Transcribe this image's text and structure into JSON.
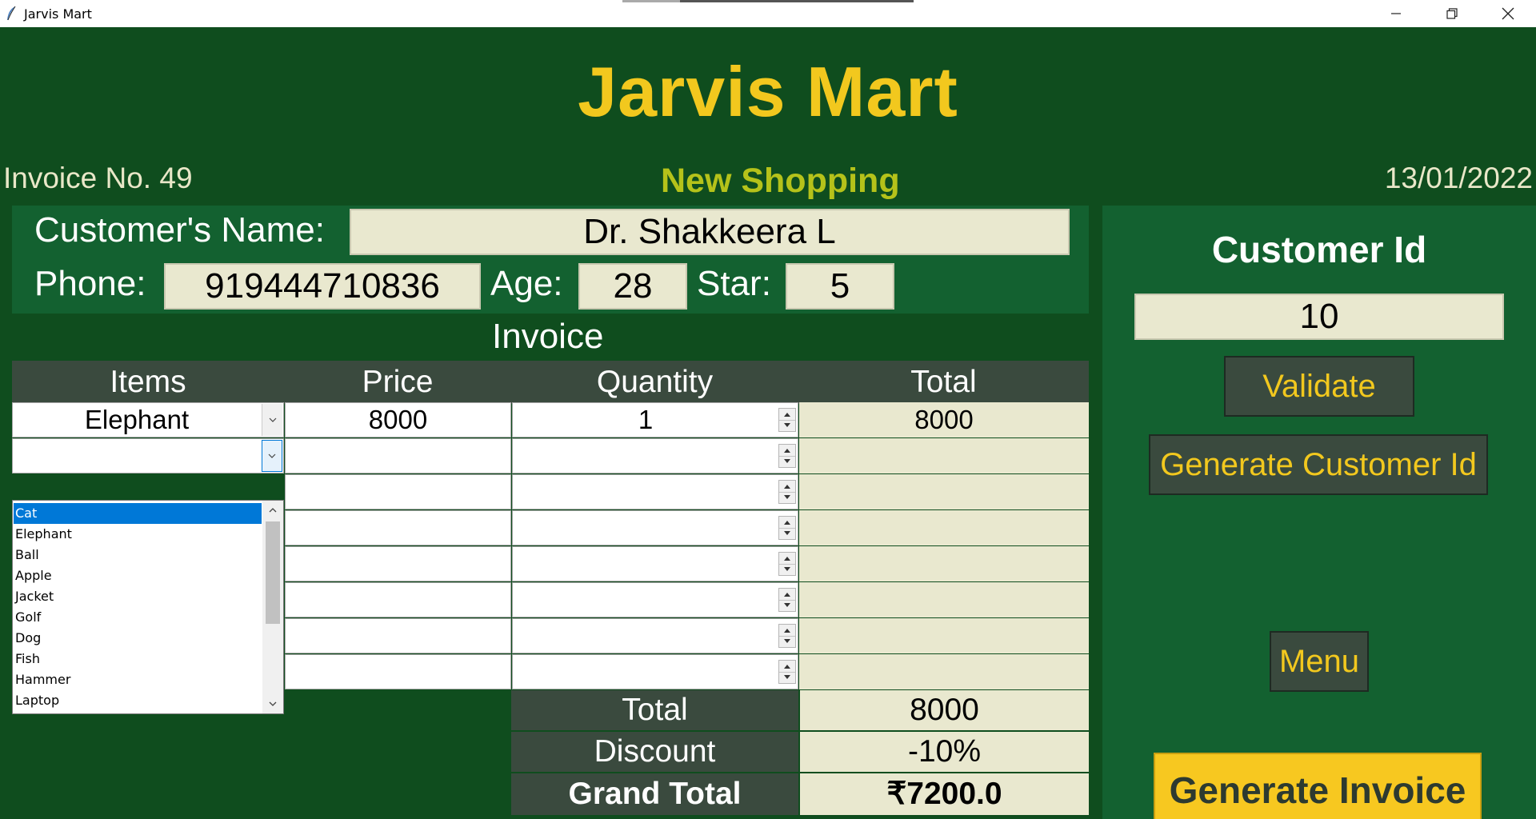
{
  "window": {
    "title": "Jarvis Mart"
  },
  "header": {
    "store_name": "Jarvis Mart",
    "invoice_label": "Invoice No.",
    "invoice_number": "49",
    "mode": "New Shopping",
    "date": "13/01/2022"
  },
  "customer": {
    "name_label": "Customer's Name:",
    "name": "Dr. Shakkeera L",
    "phone_label": "Phone:",
    "phone": "919444710836",
    "age_label": "Age:",
    "age": "28",
    "star_label": "Star:",
    "star": "5"
  },
  "invoice": {
    "title": "Invoice",
    "columns": [
      "Items",
      "Price",
      "Quantity",
      "Total"
    ],
    "rows": [
      {
        "item": "Elephant",
        "price": "8000",
        "quantity": "1",
        "total": "8000"
      },
      {
        "item": "",
        "price": "",
        "quantity": "",
        "total": ""
      },
      {
        "item": "",
        "price": "",
        "quantity": "",
        "total": ""
      },
      {
        "item": "",
        "price": "",
        "quantity": "",
        "total": ""
      },
      {
        "item": "",
        "price": "",
        "quantity": "",
        "total": ""
      },
      {
        "item": "",
        "price": "",
        "quantity": "",
        "total": ""
      },
      {
        "item": "",
        "price": "",
        "quantity": "",
        "total": ""
      },
      {
        "item": "",
        "price": "",
        "quantity": "",
        "total": ""
      }
    ],
    "dropdown_options": [
      "Cat",
      "Elephant",
      "Ball",
      "Apple",
      "Jacket",
      "Golf",
      "Dog",
      "Fish",
      "Hammer",
      "Laptop"
    ],
    "dropdown_selected": "Cat",
    "summary": {
      "total_label": "Total",
      "total": "8000",
      "discount_label": "Discount",
      "discount": "-10%",
      "grand_total_label": "Grand Total",
      "grand_total": "₹7200.0"
    }
  },
  "sidebar": {
    "customer_id_label": "Customer Id",
    "customer_id": "10",
    "validate_label": "Validate",
    "generate_id_label": "Generate Customer Id",
    "menu_label": "Menu",
    "generate_invoice_label": "Generate Invoice"
  },
  "colors": {
    "background": "#0f4d1e",
    "panel": "#136130",
    "accent_yellow": "#f2c81e",
    "field": "#e9e8cf",
    "header_cells": "#3a4a3e"
  }
}
